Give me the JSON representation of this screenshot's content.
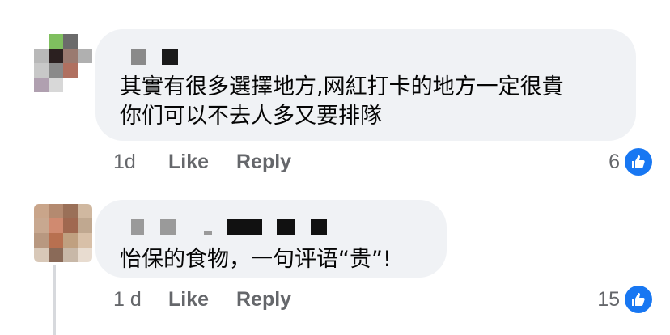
{
  "comments": [
    {
      "text_lines": [
        "其實有很多選擇地方,网紅打卡的地方一定很貴",
        "你们可以不去人多又要排隊"
      ],
      "time": "1d",
      "like_label": "Like",
      "reply_label": "Reply",
      "reaction_count": "6"
    },
    {
      "text_lines": [
        "怡保的食物，一句评语“贵”!"
      ],
      "time": "1 d",
      "like_label": "Like",
      "reply_label": "Reply",
      "reaction_count": "15"
    }
  ],
  "icons": {
    "reaction": "thumbs-up-icon"
  },
  "colors": {
    "bubble": "#f0f2f5",
    "meta_text": "#65676b",
    "like_blue": "#1877f2"
  }
}
